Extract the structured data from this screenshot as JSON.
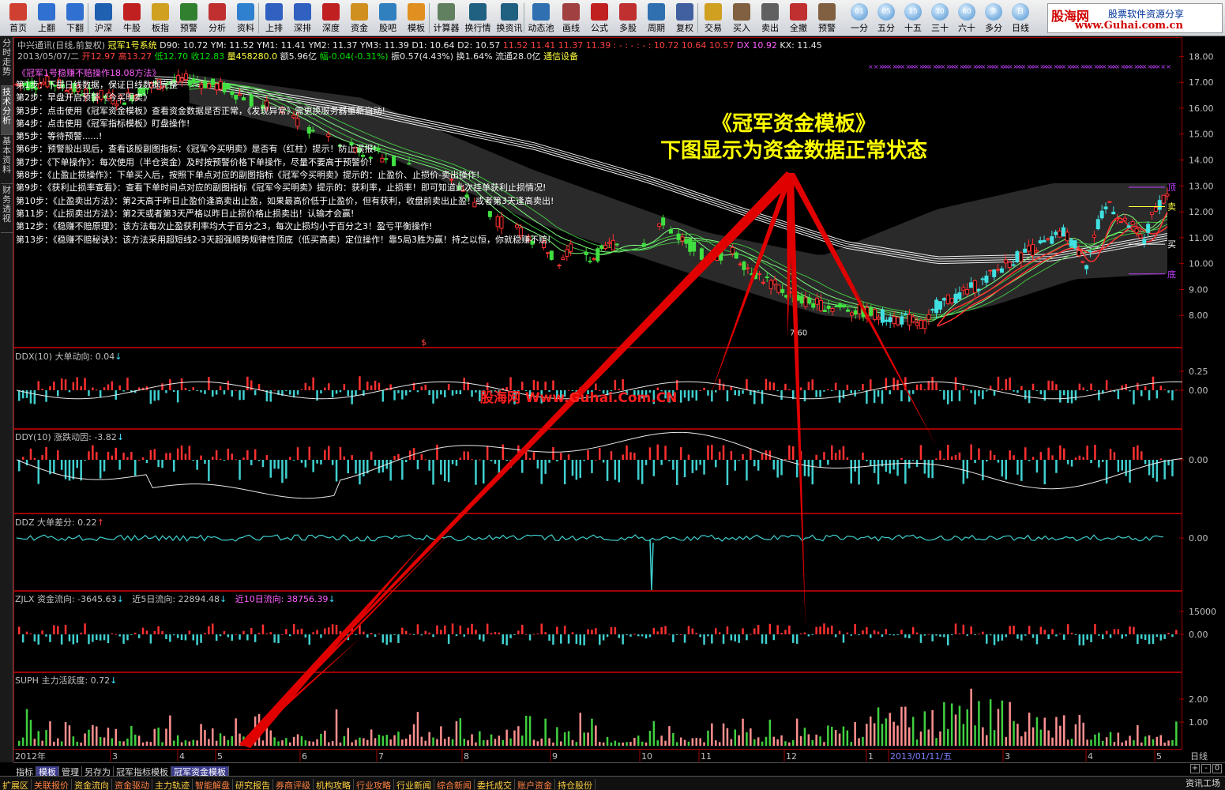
{
  "toolbar": {
    "buttons": [
      {
        "label": "首页",
        "icon": "home-icon",
        "color": "#d04030"
      },
      {
        "label": "上翻",
        "icon": "arrow-up-icon",
        "color": "#3070d0"
      },
      {
        "label": "下翻",
        "icon": "arrow-down-icon",
        "color": "#3070d0"
      },
      {
        "label": "沪深",
        "icon": "yen-icon",
        "color": "#2060b0"
      },
      {
        "label": "牛股",
        "icon": "f6-icon",
        "color": "#c02020"
      },
      {
        "label": "板指",
        "icon": "sector-icon",
        "color": "#d0a020"
      },
      {
        "label": "预警",
        "icon": "alert-chart-icon",
        "color": "#308030"
      },
      {
        "label": "分析",
        "icon": "analysis-chart-icon",
        "color": "#c03030"
      },
      {
        "label": "资料",
        "icon": "document-icon",
        "color": "#3080d0"
      },
      {
        "label": "上排",
        "icon": "sort-up-icon",
        "color": "#3060c0"
      },
      {
        "label": "深排",
        "icon": "sort-icon",
        "color": "#3060c0"
      },
      {
        "label": "深度",
        "icon": "f9-icon",
        "color": "#c02020"
      },
      {
        "label": "资金",
        "icon": "money-icon",
        "color": "#d09020"
      },
      {
        "label": "股吧",
        "icon": "forum-icon",
        "color": "#3080c0"
      },
      {
        "label": "模板",
        "icon": "l2-icon",
        "color": "#e09020"
      },
      {
        "label": "计算器",
        "icon": "calculator-icon",
        "color": "#608060"
      },
      {
        "label": "换行情",
        "icon": "quote-monitor-icon",
        "color": "#206080"
      },
      {
        "label": "换资讯",
        "icon": "news-monitor-icon",
        "color": "#206080"
      },
      {
        "label": "动态池",
        "icon": "pool-icon",
        "color": "#3070b0"
      },
      {
        "label": "画线",
        "icon": "pencil-icon",
        "color": "#a04040"
      },
      {
        "label": "公式",
        "icon": "formula-icon",
        "color": "#c02020"
      },
      {
        "label": "多股",
        "icon": "multi-stock-icon",
        "color": "#c03030"
      },
      {
        "label": "周期",
        "icon": "period-icon",
        "color": "#3070b0"
      },
      {
        "label": "复权",
        "icon": "restore-rights-icon",
        "color": "#4060a0"
      },
      {
        "label": "交易",
        "icon": "trade-icon",
        "color": "#d0a020"
      },
      {
        "label": "买入",
        "icon": "buy-icon",
        "color": "#806040"
      },
      {
        "label": "卖出",
        "icon": "sell-icon",
        "color": "#606060"
      },
      {
        "label": "全撤",
        "icon": "cancel-all-icon",
        "color": "#c03030"
      },
      {
        "label": "预警",
        "icon": "grid-alert-icon",
        "color": "#806040"
      }
    ],
    "periods": [
      "一分",
      "五分",
      "十五",
      "三十",
      "六十",
      "多分",
      "日线"
    ],
    "period_icons": [
      "01",
      "05",
      "15",
      "30",
      "60",
      "多",
      "日"
    ]
  },
  "logo": {
    "main": "股海网",
    "sub": "股票软件资源分享",
    "url": "www.Guhai.com.cn"
  },
  "left_tabs": [
    "分时走势",
    "技术分析",
    "基本资料",
    "财务透视"
  ],
  "info_line1": {
    "prefix": "中兴通讯(日线,前复权)",
    "indicator": "冠军1号系统",
    "d90": "D90: 10.72",
    "ym": "YM: 11.52",
    "ym1": "YM1: 11.41",
    "ym2": "YM2: 11.37",
    "ym3": "YM3: 11.39",
    "d1": "D1: 10.64",
    "d2": "D2: 10.57",
    "vals": "11.52  11.41  11.37  11.39  : - : - : - : 10.72  10.64  10.57",
    "dx": "DX 10.92",
    "kx": "KX: 11.45"
  },
  "info_line2": {
    "date": "2013/05/07/二",
    "open": "开12.97",
    "high": "高13.27",
    "low": "低12.70",
    "close": "收12.83",
    "vol": "量458280.0",
    "amount": "额5.96亿",
    "change": "幅-0.04(-0.31%)",
    "amp": "振0.57(4.43%)",
    "turnover": "换1.64%",
    "float": "流通28.0亿",
    "industry": "通信设备"
  },
  "steps_title": "《冠军1号稳赚不赔操作18.08方法》",
  "steps": [
    "第1步：下载日线数据，保证日线数据完整",
    "第2步：早盘开启预警《今买明卖》",
    "第3步：点击使用《冠军资金模板》查看资金数据是否正常，《发现异常》需更换服务器重新启动!",
    "第4步：点击使用《冠军指标模板》盯盘操作!",
    "第5步：等待预警......!",
    "第6步：预警股出现后，查看该股副图指标：《冠军今买明卖》是否有（红柱）提示！防止误报!",
    "第7步：《下单操作》：每次使用（半仓资金）及时按预警价格下单操作，尽量不要高于预警价!",
    "第8步：《止盈止损操作》：下单买入后，按照下单点对应的副图指标《冠军今买明卖》提示的：止盈价、止损价-卖出操作!",
    "第9步：《获利止损率查看》：查看下单时间点对应的副图指标《冠军今买明卖》提示的：获利率，止损率！即可知道此次挂单获利止损情况!",
    "第10步：《止盈卖出方法》：第2天高于昨日止盈价逢高卖出止盈，如果最高价低于止盈价，但有获利，收盘前卖出止盈！或者第3天逢高卖出!",
    "第11步：《止损卖出方法》：第2天或者第3天严格以昨日止损价格止损卖出！认输才会赢!",
    "第12步：《稳赚不赔原理》：该方法每次止盈获利率均大于百分之3，每次止损均小于百分之3！盈亏平衡操作!",
    "第13步：《稳赚不赔秘诀》：该方法采用超短线2-3天超强顺势规律性顶底（低买高卖）定位操作！靠5局3胜为赢！持之以恒，你就稳赚不赔!"
  ],
  "banner": {
    "line1": "《冠军资金模板》",
    "line2": "下图显示为资金数据正常状态"
  },
  "watermark": "股海网 Www.Guhai.Com.CN",
  "chart_markers": {
    "top": "顶",
    "sell": "卖",
    "buy": "买",
    "bottom": "底",
    "low_label": "7.60",
    "dollar": "$"
  },
  "panels": {
    "ddx": {
      "name": "DDX(10)",
      "label": "大单动向: 0.04",
      "trend": "↓",
      "ticks": [
        "0.25",
        "0.00"
      ]
    },
    "ddy": {
      "name": "DDY(10)",
      "label": "涨跌动因: -3.82",
      "trend": "↓",
      "ticks": [
        "0.00"
      ]
    },
    "ddz": {
      "name": "DDZ",
      "label": "大单差分: 0.22",
      "trend": "↑",
      "ticks": [
        "0.00"
      ]
    },
    "zjlx": {
      "name": "ZJLX",
      "label": "资金流向: -3645.63",
      "trend": "↓",
      "l5": "近5日流向: 22894.48",
      "l5t": "↓",
      "l10": "近10日流向: 38756.39",
      "l10t": "↓",
      "ticks": [
        "15000",
        "0.00"
      ]
    },
    "suph": {
      "name": "SUPH",
      "label": "主力活跃度: 0.72",
      "trend": "↓",
      "ticks": [
        "2.00",
        "1.00"
      ]
    }
  },
  "chart_data": {
    "type": "candlestick",
    "title": "",
    "price_axis": {
      "ticks": [
        "18.00",
        "17.00",
        "16.00",
        "15.00",
        "14.00",
        "13.00",
        "12.00",
        "11.00",
        "10.00",
        "9.00",
        "8.00"
      ],
      "range": [
        7.0,
        18.5
      ]
    },
    "x_axis": {
      "ticks": [
        "2012年",
        "3",
        "4",
        "5",
        "6",
        "7",
        "8",
        "9",
        "10",
        "11",
        "12",
        "1",
        "2013/01/11/五",
        "3",
        "4",
        "5"
      ],
      "period": "日线"
    },
    "price_path": [
      [
        0.0,
        16.9
      ],
      [
        0.03,
        17.0
      ],
      [
        0.06,
        16.6
      ],
      [
        0.09,
        16.3
      ],
      [
        0.12,
        16.9
      ],
      [
        0.15,
        17.1
      ],
      [
        0.18,
        16.8
      ],
      [
        0.21,
        16.2
      ],
      [
        0.24,
        15.6
      ],
      [
        0.27,
        14.8
      ],
      [
        0.3,
        14.4
      ],
      [
        0.33,
        14.0
      ],
      [
        0.36,
        13.6
      ],
      [
        0.38,
        13.2
      ],
      [
        0.4,
        12.3
      ],
      [
        0.42,
        11.6
      ],
      [
        0.44,
        11.2
      ],
      [
        0.46,
        10.7
      ],
      [
        0.47,
        10.1
      ],
      [
        0.48,
        10.6
      ],
      [
        0.5,
        10.2
      ],
      [
        0.52,
        10.8
      ],
      [
        0.54,
        10.6
      ],
      [
        0.56,
        11.6
      ],
      [
        0.58,
        10.9
      ],
      [
        0.6,
        10.2
      ],
      [
        0.62,
        10.5
      ],
      [
        0.64,
        9.7
      ],
      [
        0.66,
        9.1
      ],
      [
        0.68,
        8.6
      ],
      [
        0.7,
        8.4
      ],
      [
        0.72,
        8.3
      ],
      [
        0.74,
        8.1
      ],
      [
        0.76,
        7.9
      ],
      [
        0.78,
        7.8
      ],
      [
        0.79,
        7.6
      ],
      [
        0.8,
        8.4
      ],
      [
        0.82,
        8.8
      ],
      [
        0.84,
        9.3
      ],
      [
        0.86,
        10.0
      ],
      [
        0.88,
        10.5
      ],
      [
        0.9,
        10.9
      ],
      [
        0.91,
        11.2
      ],
      [
        0.92,
        10.7
      ],
      [
        0.93,
        10.0
      ],
      [
        0.94,
        11.5
      ],
      [
        0.95,
        12.4
      ],
      [
        0.96,
        11.6
      ],
      [
        0.97,
        11.4
      ],
      [
        0.98,
        10.8
      ],
      [
        0.985,
        11.6
      ],
      [
        0.99,
        12.1
      ],
      [
        1.0,
        12.8
      ]
    ],
    "ma_white": [
      [
        0.0,
        17.2
      ],
      [
        0.15,
        16.9
      ],
      [
        0.3,
        15.8
      ],
      [
        0.45,
        14.4
      ],
      [
        0.55,
        13.1
      ],
      [
        0.65,
        11.6
      ],
      [
        0.72,
        10.6
      ],
      [
        0.8,
        10.0
      ],
      [
        0.9,
        10.1
      ],
      [
        1.0,
        10.9
      ]
    ],
    "band_upper": [
      [
        0.15,
        17.3
      ],
      [
        0.3,
        16.4
      ],
      [
        0.45,
        13.6
      ],
      [
        0.6,
        11.2
      ],
      [
        0.7,
        10.3
      ],
      [
        0.8,
        12.1
      ],
      [
        0.9,
        13.1
      ],
      [
        1.0,
        13.1
      ]
    ],
    "band_lower": [
      [
        0.15,
        16.2
      ],
      [
        0.3,
        14.6
      ],
      [
        0.45,
        11.6
      ],
      [
        0.6,
        9.4
      ],
      [
        0.7,
        8.0
      ],
      [
        0.78,
        7.7
      ],
      [
        0.85,
        8.4
      ],
      [
        0.92,
        9.4
      ],
      [
        1.0,
        9.6
      ]
    ],
    "levels": {
      "top": 12.95,
      "sell": 12.2,
      "buy": 10.75,
      "bottom": 9.6
    }
  }
}
